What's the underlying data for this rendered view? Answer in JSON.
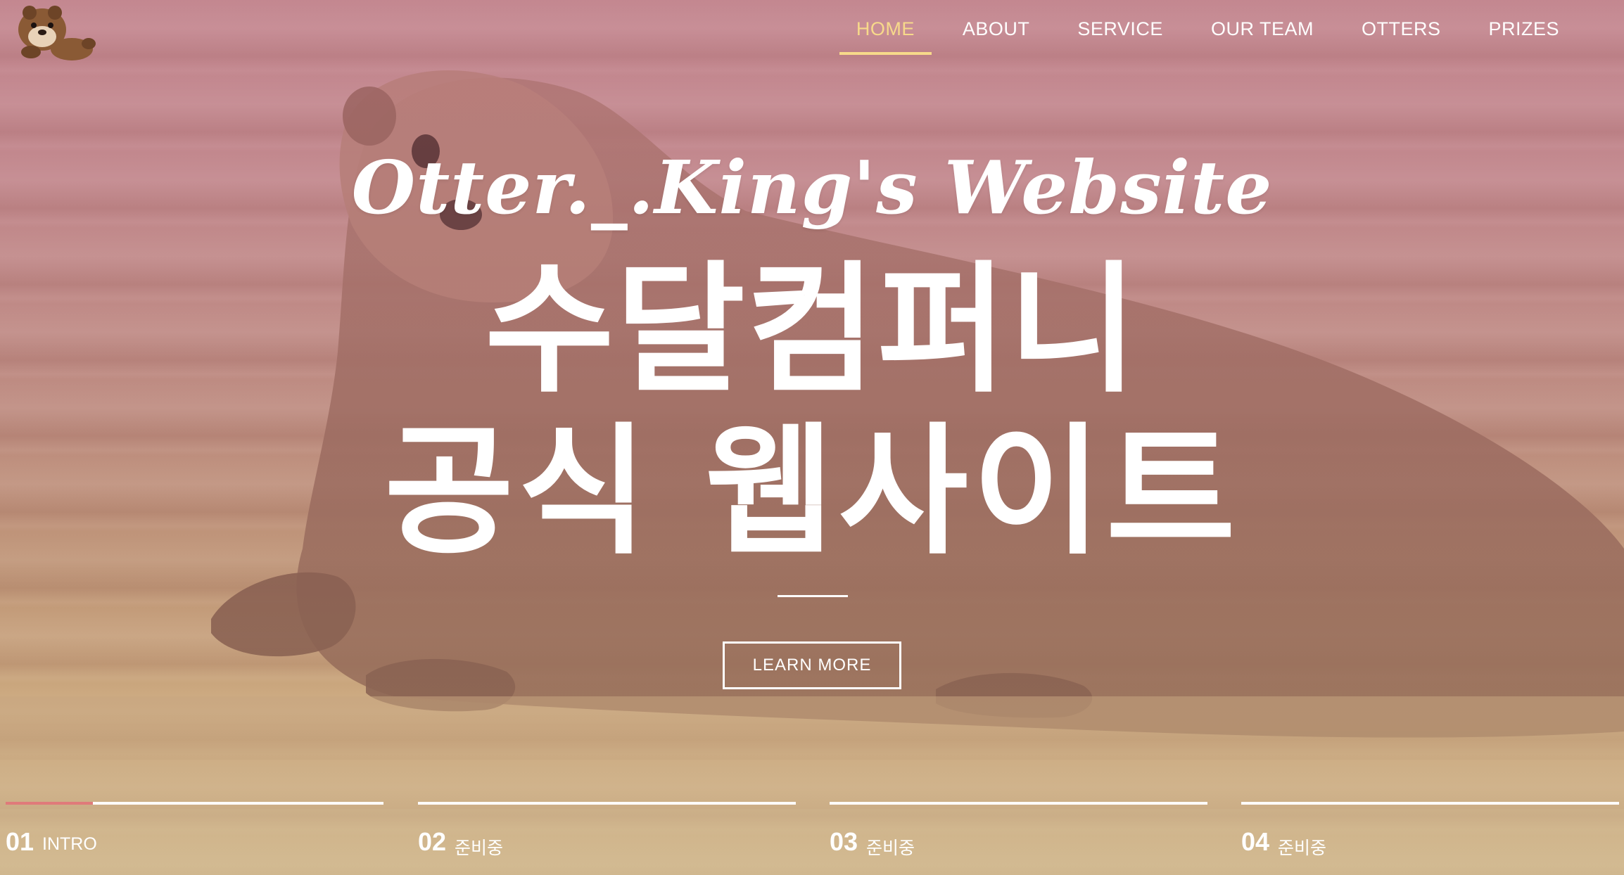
{
  "logo": {
    "icon": "otter-emoji-icon"
  },
  "nav": {
    "items": [
      {
        "label": "HOME",
        "active": true
      },
      {
        "label": "ABOUT",
        "active": false
      },
      {
        "label": "SERVICE",
        "active": false
      },
      {
        "label": "OUR TEAM",
        "active": false
      },
      {
        "label": "OTTERS",
        "active": false
      },
      {
        "label": "PRIZES",
        "active": false
      }
    ],
    "active_color": "#f7d98a"
  },
  "hero": {
    "script_title": "Otter._.King's Website",
    "title_line1": "수달컴퍼니",
    "title_line2": "공식 웹사이트",
    "cta_label": "LEARN MORE"
  },
  "slides": [
    {
      "number": "01",
      "label": "INTRO",
      "progress": 0.23
    },
    {
      "number": "02",
      "label": "준비중",
      "progress": 0
    },
    {
      "number": "03",
      "label": "준비중",
      "progress": 0
    },
    {
      "number": "04",
      "label": "준비중",
      "progress": 0
    }
  ],
  "colors": {
    "progress": "#e07a7a",
    "text": "#ffffff"
  }
}
